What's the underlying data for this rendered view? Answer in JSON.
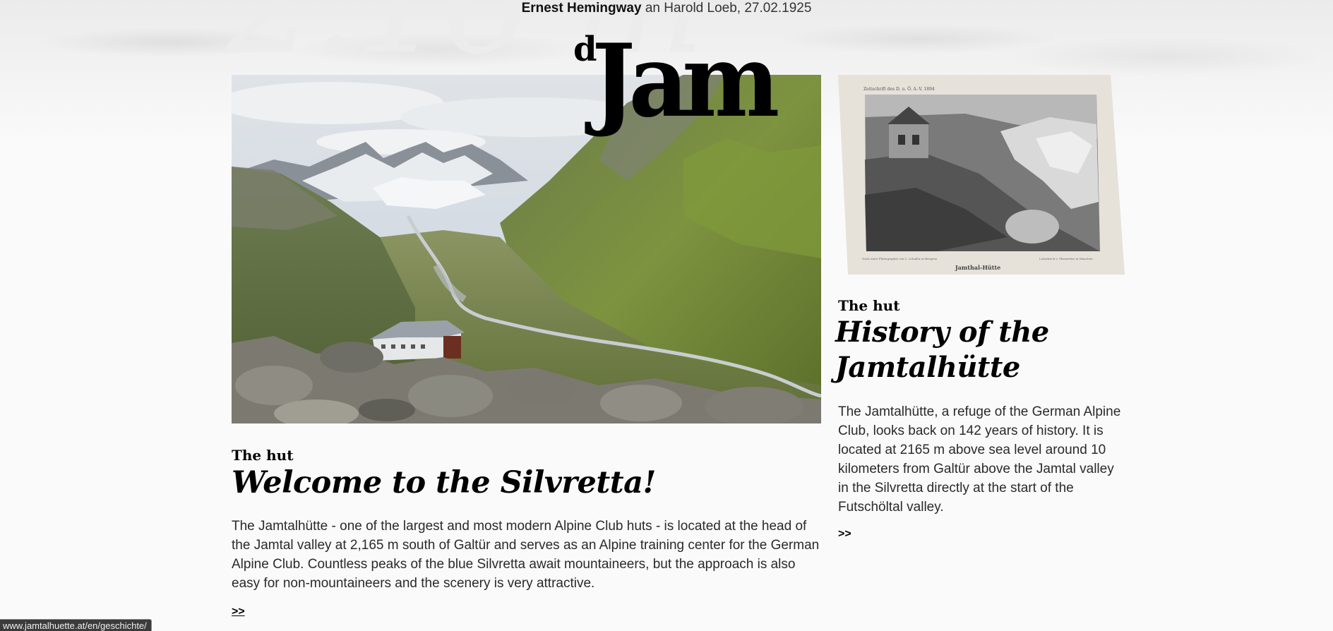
{
  "background_number": "2.16 m",
  "quote": {
    "author": "Ernest Hemingway",
    "rest": "an Harold Loeb, 27.02.1925"
  },
  "logo": {
    "small": "d",
    "main": "Jam"
  },
  "welcome_section": {
    "kicker": "The hut",
    "title": "Welcome to the Silvretta!",
    "body": "The Jamtalhütte - one of the largest and most modern Alpine Club huts - is located at the head of the Jamtal valley at 2,165 m south of Galtür and serves as an Alpine training center for the German Alpine Club. Countless peaks of the blue Silvretta await mountaineers, but the approach is also easy for non-mountaineers and the scenery is very attractive.",
    "link": ">>"
  },
  "history_section": {
    "photo_caption_top": "Zeitschrift des D. u. Ö. A.-V. 1894",
    "photo_caption_left": "Nach einer Photographie von L. Schaller in Bregenz",
    "photo_caption_center": "Jamthal-Hütte",
    "photo_caption_right": "Lichtdruck v. Obernetter in München",
    "kicker": "The hut",
    "title": "History of the Jamtalhütte",
    "body": "The Jamtalhütte, a refuge of the German Alpine Club, looks back on 142 years of history. It is located at 2165 m above sea level around 10 kilometers from Galtür above the Jamtal valley in the Silvretta directly at the start of the Futschöltal valley.",
    "link": ">>"
  },
  "status_bar": {
    "url": "www.jamtalhuette.at/en/geschichte/"
  }
}
